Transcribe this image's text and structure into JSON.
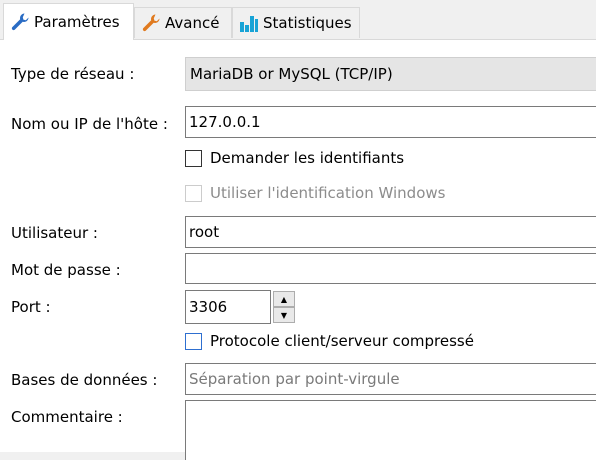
{
  "tabs": [
    {
      "label": "Paramètres",
      "icon": "wrench-icon",
      "active": true
    },
    {
      "label": "Avancé",
      "icon": "wrench-icon",
      "active": false
    },
    {
      "label": "Statistiques",
      "icon": "bar-chart-icon",
      "active": false
    }
  ],
  "form": {
    "network_type": {
      "label": "Type de réseau :",
      "value": "MariaDB or MySQL (TCP/IP)"
    },
    "host": {
      "label": "Nom ou IP de l'hôte :",
      "value": "127.0.0.1"
    },
    "ask_credentials": {
      "label": "Demander les identifiants",
      "checked": false
    },
    "windows_auth": {
      "label": "Utiliser l'identification Windows",
      "checked": false,
      "disabled": true
    },
    "user": {
      "label": "Utilisateur :",
      "value": "root"
    },
    "password": {
      "label": "Mot de passe :",
      "value": ""
    },
    "port": {
      "label": "Port :",
      "value": "3306"
    },
    "compressed": {
      "label": "Protocole client/serveur compressé",
      "checked": false
    },
    "databases": {
      "label": "Bases de données :",
      "placeholder": "Séparation par point-virgule",
      "value": ""
    },
    "comment": {
      "label": "Commentaire :",
      "value": ""
    }
  },
  "colors": {
    "wrench_blue": "#2a6cc4",
    "wrench_orange": "#e07a1f",
    "chart_cyan": "#17a3d6",
    "checkbox_focus": "#2e6fd0"
  }
}
